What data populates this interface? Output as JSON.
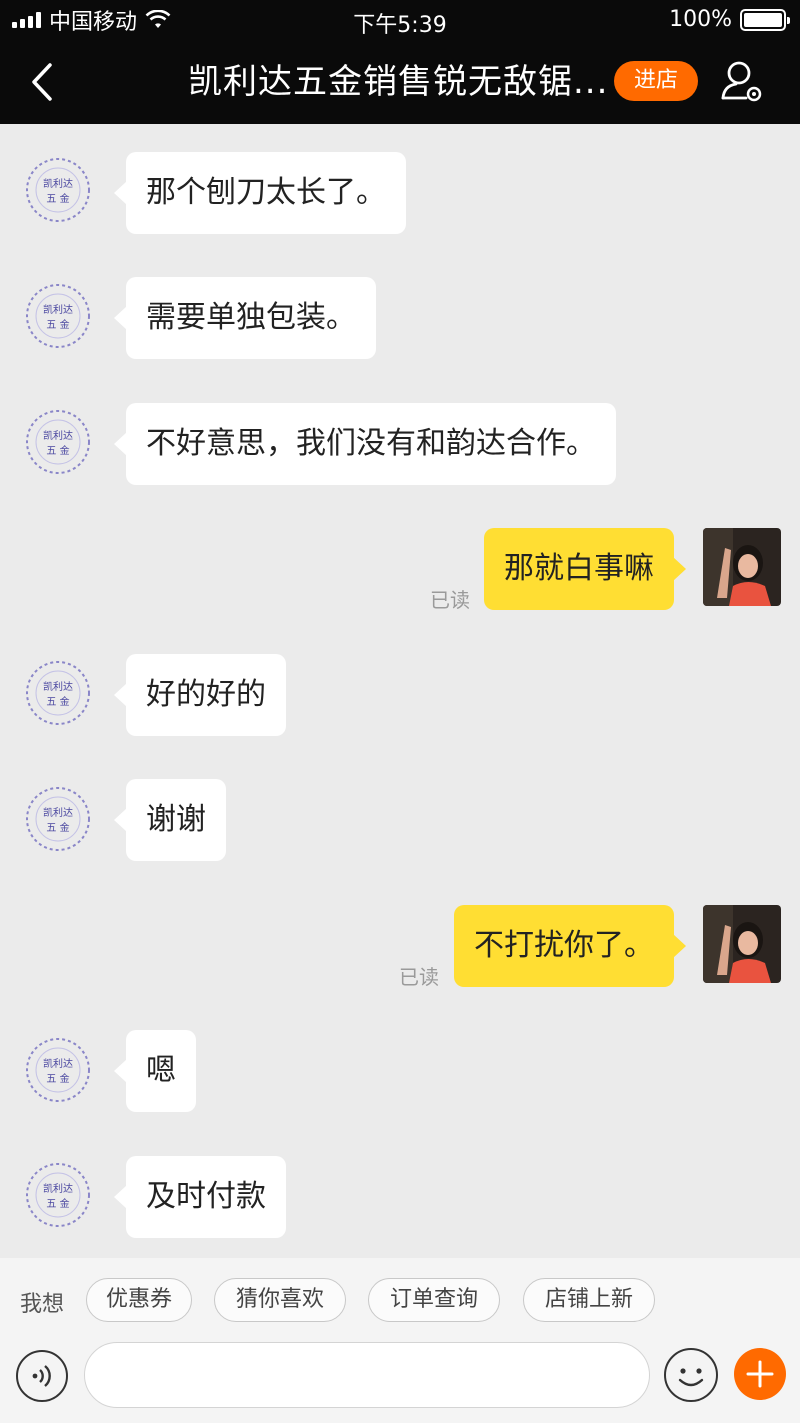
{
  "status_bar": {
    "carrier": "中国移动",
    "time": "下午5:39",
    "battery": "100%",
    "battery_level": 1.0
  },
  "nav": {
    "title": "凯利达五金销售锐无敌锯...",
    "enter_shop_label": "进店",
    "accent_color": "#ff6a00"
  },
  "chat": {
    "messages": [
      {
        "side": "left",
        "text": "那个刨刀太长了。"
      },
      {
        "side": "left",
        "text": "需要单独包装。"
      },
      {
        "side": "left",
        "text": "不好意思，我们没有和韵达合作。"
      },
      {
        "side": "right",
        "text": "那就白事嘛",
        "status": "已读"
      },
      {
        "side": "left",
        "text": "好的好的"
      },
      {
        "side": "left",
        "text": "谢谢"
      },
      {
        "side": "right",
        "text": "不打扰你了。",
        "status": "已读"
      },
      {
        "side": "left",
        "text": "嗯"
      },
      {
        "side": "left",
        "text": "及时付款"
      }
    ],
    "seller_avatar": {
      "text_line1": "凯利达",
      "text_line2": "五  金",
      "icon": "shop-stamp-icon"
    },
    "bubble_colors": {
      "incoming": "#ffffff",
      "outgoing": "#ffde33"
    }
  },
  "quick_replies": {
    "label": "我想",
    "chips": [
      "优惠券",
      "猜你喜欢",
      "订单查询",
      "店铺上新"
    ]
  },
  "input": {
    "value": "",
    "voice_icon": "voice-icon",
    "emoji_icon": "emoji-icon",
    "plus_icon": "plus-icon"
  }
}
